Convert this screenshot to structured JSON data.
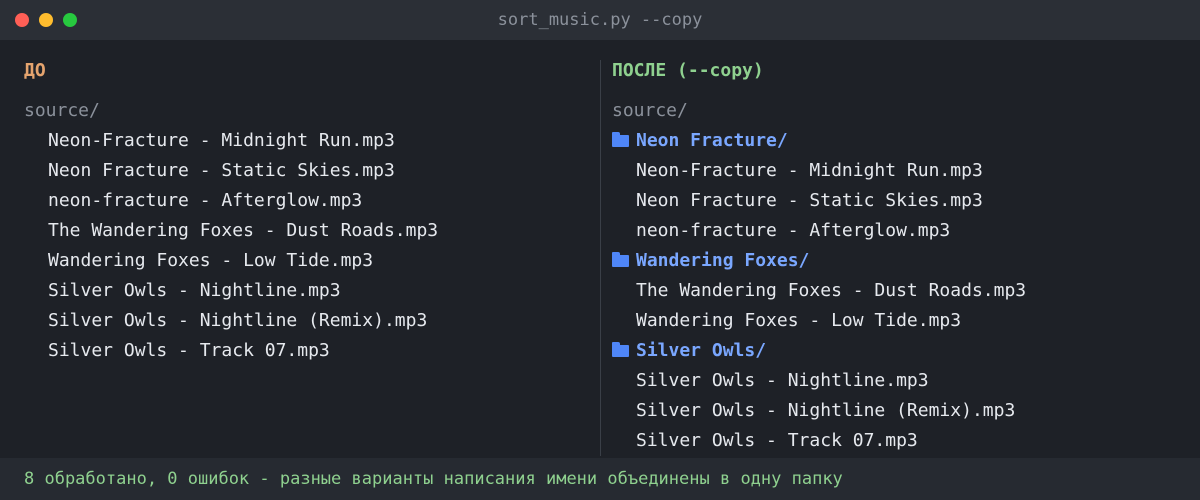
{
  "window": {
    "title": "sort_music.py --copy"
  },
  "before": {
    "title": "ДО",
    "root": "source/",
    "files": [
      "Neon-Fracture - Midnight Run.mp3",
      "Neon Fracture - Static Skies.mp3",
      "neon-fracture - Afterglow.mp3",
      "The Wandering Foxes - Dust Roads.mp3",
      "Wandering Foxes - Low Tide.mp3",
      "Silver Owls - Nightline.mp3",
      "Silver Owls - Nightline (Remix).mp3",
      "Silver Owls - Track 07.mp3"
    ]
  },
  "after": {
    "title": "ПОСЛЕ (--copy)",
    "root": "source/",
    "folders": [
      {
        "name": "Neon Fracture/",
        "files": [
          "Neon-Fracture - Midnight Run.mp3",
          "Neon Fracture - Static Skies.mp3",
          "neon-fracture - Afterglow.mp3"
        ]
      },
      {
        "name": "Wandering Foxes/",
        "files": [
          "The Wandering Foxes - Dust Roads.mp3",
          "Wandering Foxes - Low Tide.mp3"
        ]
      },
      {
        "name": "Silver Owls/",
        "files": [
          "Silver Owls - Nightline.mp3",
          "Silver Owls - Nightline (Remix).mp3",
          "Silver Owls - Track 07.mp3"
        ]
      }
    ]
  },
  "status": {
    "text": "8 обработано, 0 ошибок - разные варианты написания имени объединены в одну папку"
  },
  "colors": {
    "background": "#1e2127",
    "before_title": "#e5a46e",
    "after_title": "#8fd18f",
    "folder": "#7aa7ff",
    "folder_icon": "#4f86f7",
    "status": "#8fd18f"
  },
  "icons": {
    "folder": "folder-icon"
  }
}
